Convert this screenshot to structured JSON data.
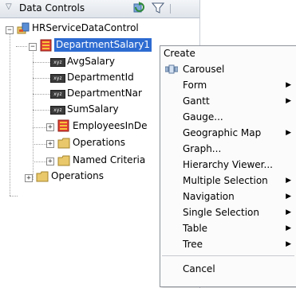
{
  "panel": {
    "title": "Data Controls",
    "title_icon": "chevron-down-icon",
    "tools": [
      "refresh-icon",
      "filter-icon"
    ]
  },
  "tree": {
    "root": {
      "label": "HRServiceDataControl",
      "icon": "data-control-icon"
    },
    "collection": {
      "label": "DepartmentSalary1",
      "icon": "collection-icon",
      "selected": true
    },
    "attributes": [
      {
        "label": "AvgSalary",
        "icon": "attribute-icon"
      },
      {
        "label": "DepartmentId",
        "icon": "attribute-icon"
      },
      {
        "label": "DepartmentNar",
        "icon": "attribute-icon"
      },
      {
        "label": "SumSalary",
        "icon": "attribute-icon"
      }
    ],
    "child_collection": {
      "label": "EmployeesInDe",
      "icon": "collection-icon"
    },
    "child_folders": [
      {
        "label": "Operations",
        "icon": "folder-icon"
      },
      {
        "label": "Named Criteria",
        "icon": "folder-icon"
      }
    ],
    "root_folder": {
      "label": "Operations",
      "icon": "folder-icon"
    }
  },
  "context_menu": {
    "header": "Create",
    "items": [
      {
        "label": "Carousel",
        "icon": "carousel-icon",
        "submenu": false
      },
      {
        "label": "Form",
        "submenu": true
      },
      {
        "label": "Gantt",
        "submenu": true
      },
      {
        "label": "Gauge...",
        "submenu": false
      },
      {
        "label": "Geographic Map",
        "submenu": true
      },
      {
        "label": "Graph...",
        "submenu": false
      },
      {
        "label": "Hierarchy Viewer...",
        "submenu": false
      },
      {
        "label": "Multiple Selection",
        "submenu": true
      },
      {
        "label": "Navigation",
        "submenu": true
      },
      {
        "label": "Single Selection",
        "submenu": true
      },
      {
        "label": "Table",
        "submenu": true
      },
      {
        "label": "Tree",
        "submenu": true
      }
    ],
    "cancel": "Cancel"
  },
  "colors": {
    "selection": "#2d6bd1",
    "folder": "#e8c86a",
    "collection": "#e34234"
  }
}
